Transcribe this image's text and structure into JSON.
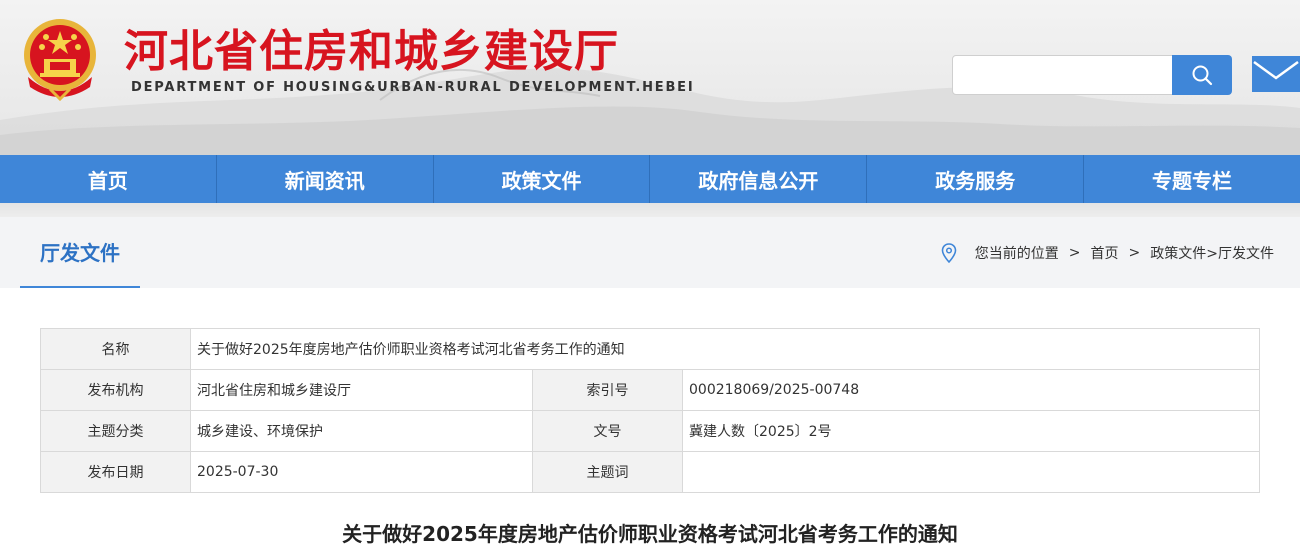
{
  "header": {
    "title": "河北省住房和城乡建设厅",
    "subtitle": "DEPARTMENT OF HOUSING&URBAN-RURAL DEVELOPMENT.HEBEI",
    "emblem_icon": "national-emblem-icon",
    "search": {
      "placeholder": "",
      "value": "",
      "icon": "search-icon"
    },
    "mail_icon": "mail-icon",
    "title_color": "#d7141f",
    "accent_color": "#3f86d8"
  },
  "nav": {
    "items": [
      {
        "label": "首页"
      },
      {
        "label": "新闻资讯"
      },
      {
        "label": "政策文件"
      },
      {
        "label": "政府信息公开"
      },
      {
        "label": "政务服务"
      },
      {
        "label": "专题专栏"
      }
    ]
  },
  "section": {
    "title": "厅发文件",
    "breadcrumb": {
      "location_label": "您当前的位置",
      "home": "首页",
      "path": "政策文件>厅发文件",
      "separator": ">",
      "icon": "location-pin-icon"
    }
  },
  "info": {
    "name_label": "名称",
    "name_value": "关于做好2025年度房地产估价师职业资格考试河北省考务工作的通知",
    "publisher_label": "发布机构",
    "publisher_value": "河北省住房和城乡建设厅",
    "index_label": "索引号",
    "index_value": "000218069/2025-00748",
    "topic_label": "主题分类",
    "topic_value": "城乡建设、环境保护",
    "doc_no_label": "文号",
    "doc_no_value": "冀建人数〔2025〕2号",
    "date_label": "发布日期",
    "date_value": "2025-07-30",
    "keywords_label": "主题词",
    "keywords_value": ""
  },
  "document": {
    "title": "关于做好2025年度房地产估价师职业资格考试河北省考务工作的通知"
  }
}
